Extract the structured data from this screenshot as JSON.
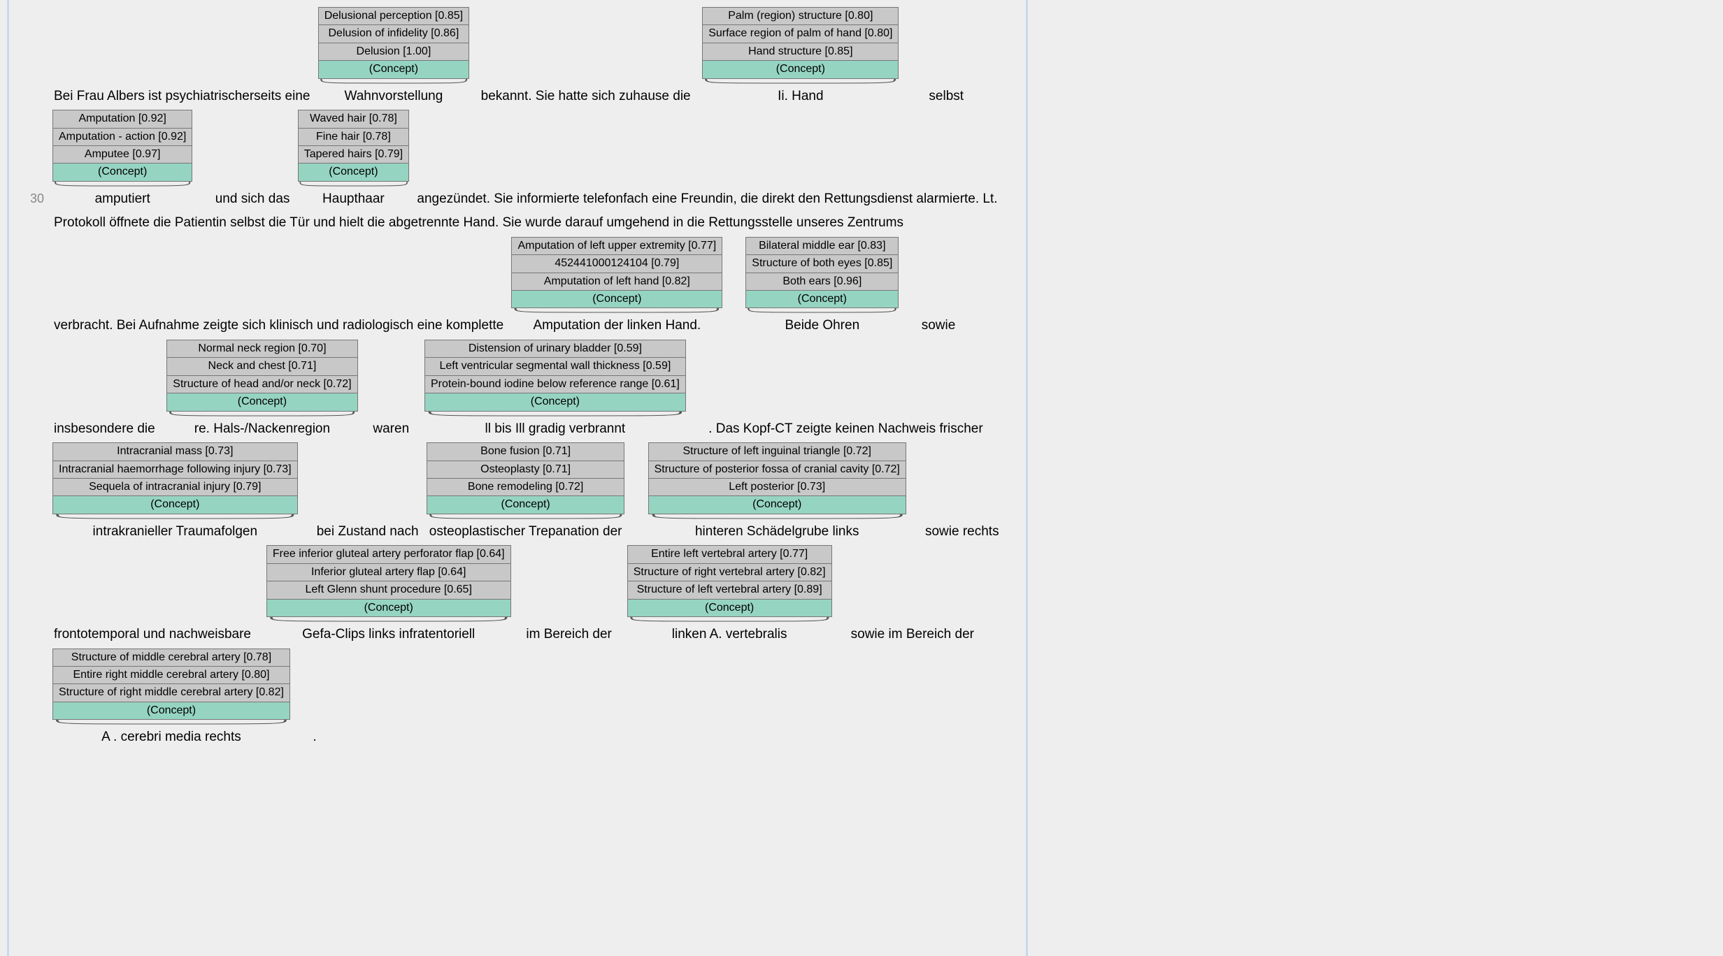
{
  "lineNumber": "30",
  "conceptLabel": "(Concept)",
  "rows": [
    [
      {
        "type": "text",
        "value": "Bei Frau Albers ist psychiatrischerseits eine "
      },
      {
        "type": "ann",
        "word": "Wahnvorstellung",
        "items": [
          "Delusional perception [0.85]",
          "Delusion of infidelity [0.86]",
          "Delusion [1.00]"
        ]
      },
      {
        "type": "text",
        "value": "  bekannt. Sie hatte sich zuhause die  "
      },
      {
        "type": "ann",
        "word": "Ii. Hand",
        "items": [
          "Palm (region) structure [0.80]",
          "Surface region of palm of hand [0.80]",
          "Hand structure [0.85]"
        ]
      },
      {
        "type": "text",
        "value": "       selbst"
      }
    ],
    [
      {
        "type": "ann",
        "word": "amputiert",
        "items": [
          "Amputation [0.92]",
          "Amputation - action [0.92]",
          "Amputee [0.97]"
        ]
      },
      {
        "type": "text",
        "value": "     und sich das "
      },
      {
        "type": "ann",
        "word": "Haupthaar",
        "items": [
          "Waved hair [0.78]",
          "Fine hair [0.78]",
          "Tapered hairs [0.79]"
        ]
      },
      {
        "type": "text",
        "value": " angezündet. Sie informierte telefonfach eine Freundin, die direkt den Rettungsdienst alarmierte. Lt."
      }
    ],
    [
      {
        "type": "text",
        "value": "Protokoll öffnete die Patientin selbst die Tür und hielt die abgetrennte Hand. Sie wurde darauf umgehend in die Rettungsstelle unseres Zentrums"
      }
    ],
    [
      {
        "type": "text",
        "value": "verbracht. Bei Aufnahme zeigte sich klinisch und radiologisch eine komplette "
      },
      {
        "type": "ann",
        "word": "Amputation der linken Hand.",
        "items": [
          "Amputation of left upper extremity [0.77]",
          "452441000124104 [0.79]",
          "Amputation of left hand [0.82]"
        ]
      },
      {
        "type": "text",
        "value": "    "
      },
      {
        "type": "ann",
        "word": "Beide Ohren",
        "items": [
          "Bilateral middle ear [0.83]",
          "Structure of both eyes [0.85]",
          "Both ears [0.96]"
        ]
      },
      {
        "type": "text",
        "value": "     sowie"
      }
    ],
    [
      {
        "type": "text",
        "value": "insbesondere die  "
      },
      {
        "type": "ann",
        "word": "re. Hals-/Nackenregion",
        "items": [
          "Normal neck region [0.70]",
          "Neck and chest [0.71]",
          "Structure of head and/or neck [0.72]"
        ]
      },
      {
        "type": "text",
        "value": "   waren   "
      },
      {
        "type": "ann",
        "word": "ll bis Ill gradig verbrannt",
        "items": [
          "Distension of urinary bladder [0.59]",
          "Left ventricular segmental wall thickness [0.59]",
          "Protein-bound iodine below reference range [0.61]"
        ]
      },
      {
        "type": "text",
        "value": "     . Das Kopf-CT zeigte keinen Nachweis frischer"
      }
    ],
    [
      {
        "type": "ann",
        "word": "intrakranieller Traumafolgen",
        "items": [
          "Intracranial mass [0.73]",
          "Intracranial haemorrhage following injury [0.73]",
          "Sequela of intracranial injury [0.79]"
        ]
      },
      {
        "type": "text",
        "value": "    bei Zustand nach "
      },
      {
        "type": "ann",
        "word": "osteoplastischer Trepanation der",
        "items": [
          "Bone fusion [0.71]",
          "Osteoplasty [0.71]",
          "Bone remodeling [0.72]"
        ]
      },
      {
        "type": "text",
        "value": "    "
      },
      {
        "type": "ann",
        "word": "hinteren Schädelgrube links",
        "items": [
          "Structure of left inguinal triangle [0.72]",
          "Structure of posterior fossa of cranial cavity [0.72]",
          "Left posterior [0.73]"
        ]
      },
      {
        "type": "text",
        "value": "    sowie rechts"
      }
    ],
    [
      {
        "type": "text",
        "value": "frontotemporal und nachweisbare   "
      },
      {
        "type": "ann",
        "word": "Gefa-Clips links infratentoriell",
        "items": [
          "Free inferior gluteal artery perforator flap [0.64]",
          "Inferior gluteal artery flap [0.64]",
          "Left Glenn shunt procedure [0.65]"
        ]
      },
      {
        "type": "text",
        "value": "   im Bereich der   "
      },
      {
        "type": "ann",
        "word": "linken A. vertebralis",
        "items": [
          "Entire left vertebral artery [0.77]",
          "Structure of right vertebral artery [0.82]",
          "Structure of left vertebral artery [0.89]"
        ]
      },
      {
        "type": "text",
        "value": "    sowie im Bereich der"
      }
    ],
    [
      {
        "type": "ann",
        "word": "A . cerebri media rechts",
        "items": [
          "Structure of middle cerebral artery [0.78]",
          "Entire right middle cerebral artery [0.80]",
          "Structure of right middle cerebral artery [0.82]"
        ]
      },
      {
        "type": "text",
        "value": "     ."
      }
    ]
  ]
}
